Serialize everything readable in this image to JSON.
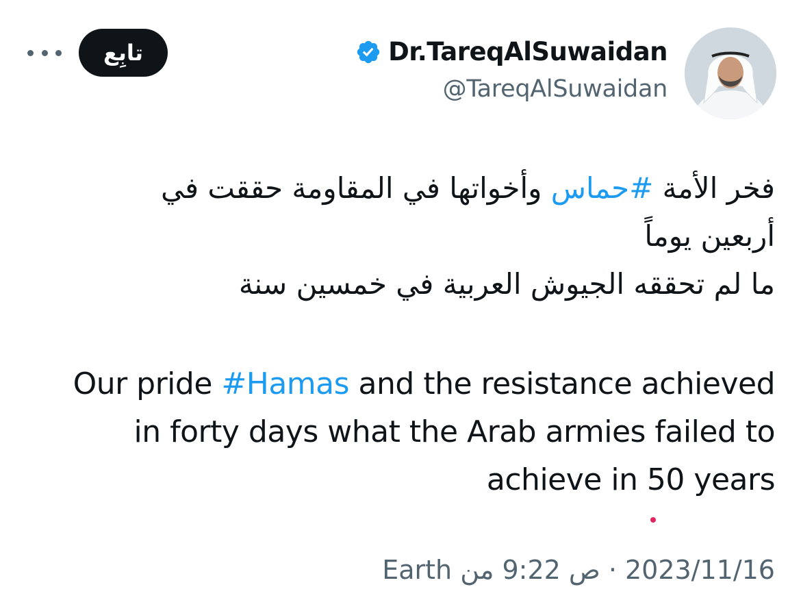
{
  "author": {
    "display_name": "Dr.TareqAlSuwaidan",
    "handle": "@TareqAlSuwaidan",
    "verified": true,
    "avatar_icon": "profile-photo"
  },
  "actions": {
    "follow_label": "تابِع",
    "more_icon": "ellipsis-icon"
  },
  "tweet": {
    "arabic_lines": [
      {
        "before": "فخر الأمة ",
        "hashtag": "#حماس",
        "after": " وأخواتها في المقاومة حققت في"
      },
      {
        "text": "أربعين يوماً"
      },
      {
        "text": "ما لم تحققه الجيوش العربية في خمسين سنة"
      }
    ],
    "english_lines": [
      {
        "before": "Our pride ",
        "hashtag": "#Hamas",
        "after": " and the resistance achieved"
      },
      {
        "text": "in forty days what the Arab armies failed to"
      },
      {
        "text": "achieve in 50 years"
      }
    ],
    "timestamp": {
      "source": "Earth من",
      "time": "ص 9:22",
      "separator": "·",
      "date": "2023/11/16"
    }
  },
  "colors": {
    "link": "#1d9bf0",
    "verified": "#1d9bf0",
    "text": "#0f1419",
    "secondary": "#536471",
    "follow_bg": "#0f1419"
  }
}
